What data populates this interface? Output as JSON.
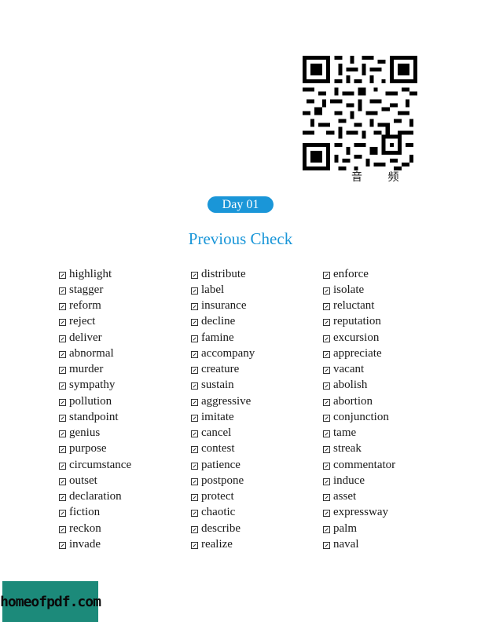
{
  "qr": {
    "caption": "音 频"
  },
  "header": {
    "day_label": "Day 01",
    "section_title": "Previous Check"
  },
  "columns": [
    [
      "highlight",
      "stagger",
      "reform",
      "reject",
      "deliver",
      "abnormal",
      "murder",
      "sympathy",
      "pollution",
      "standpoint",
      "genius",
      "purpose",
      "circumstance",
      "outset",
      "declaration",
      "fiction",
      "reckon",
      "invade"
    ],
    [
      "distribute",
      "label",
      "insurance",
      "decline",
      "famine",
      "accompany",
      "creature",
      "sustain",
      "aggressive",
      "imitate",
      "cancel",
      "contest",
      "patience",
      "postpone",
      "protect",
      "chaotic",
      "describe",
      "realize"
    ],
    [
      "enforce",
      "isolate",
      "reluctant",
      "reputation",
      "excursion",
      "appreciate",
      "vacant",
      "abolish",
      "abortion",
      "conjunction",
      "tame",
      "streak",
      "commentator",
      "induce",
      "asset",
      "expressway",
      "palm",
      "naval"
    ]
  ],
  "watermark": {
    "text": "homeofpdf.com"
  }
}
